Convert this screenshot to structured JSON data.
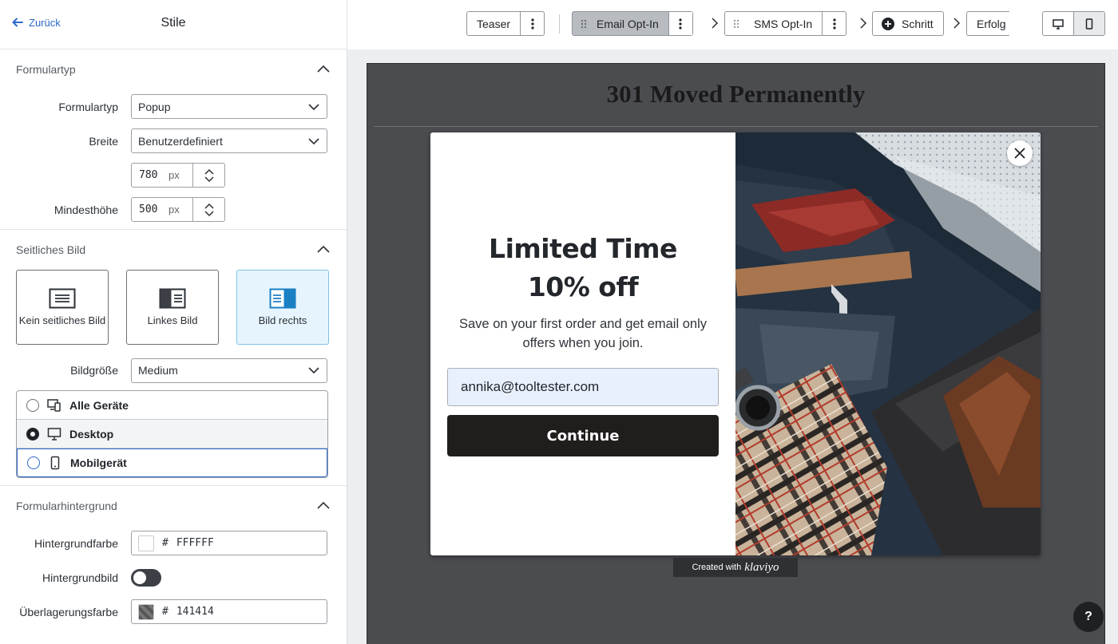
{
  "panel": {
    "back_label": "Zurück",
    "title": "Stile"
  },
  "form_type": {
    "section_title": "Formulartyp",
    "type_label": "Formulartyp",
    "type_value": "Popup",
    "width_label": "Breite",
    "width_value": "Benutzerdefiniert",
    "width_px": "780",
    "unit": "px",
    "min_height_label": "Mindesthöhe",
    "min_height_px": "500"
  },
  "side_image": {
    "section_title": "Seitliches Bild",
    "options": [
      {
        "label": "Kein seitliches Bild",
        "selected": false
      },
      {
        "label": "Linkes Bild",
        "selected": false
      },
      {
        "label": "Bild rechts",
        "selected": true
      }
    ],
    "size_label": "Bildgröße",
    "size_value": "Medium",
    "devices": [
      {
        "label": "Alle Geräte",
        "selected": false
      },
      {
        "label": "Desktop",
        "selected": true
      },
      {
        "label": "Mobilgerät",
        "selected": false
      }
    ]
  },
  "background": {
    "section_title": "Formularhintergrund",
    "bg_color_label": "Hintergrundfarbe",
    "bg_color_hash": "#",
    "bg_color_value": "FFFFFF",
    "bg_image_label": "Hintergrundbild",
    "bg_image_on": false,
    "overlay_label": "Überlagerungsfarbe",
    "overlay_hash": "#",
    "overlay_value": "141414"
  },
  "steps": {
    "teaser": "Teaser",
    "email": "Email Opt-In",
    "sms": "SMS Opt-In",
    "add_step": "Schritt",
    "success": "Erfolg"
  },
  "preview": {
    "page_title": "301 Moved Permanently",
    "popup_heading_line1": "Limited Time",
    "popup_heading_line2": "10% off",
    "popup_subtext": "Save on your first order and get email only offers when you join.",
    "email_value": "annika@tooltester.com",
    "button_label": "Continue",
    "created_with": "Created with",
    "brand": "klaviyo"
  },
  "help_label": "?",
  "colors": {
    "accent": "#2d6ac9",
    "popup_button": "#211d1c",
    "preview_bg": "#4a4c50"
  }
}
